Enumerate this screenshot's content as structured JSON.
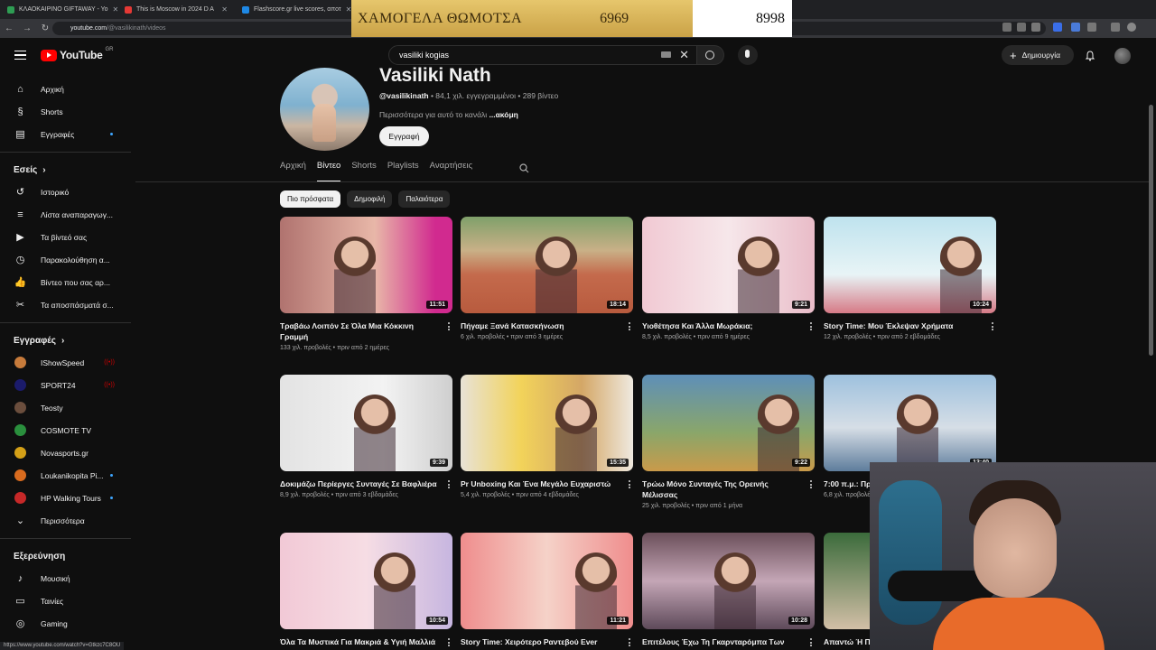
{
  "browser": {
    "tabs": [
      {
        "title": "ΚΛΑΟΚΑΙΡΙΝΟ GIFTAWAY - Yo",
        "color": "#2e9d53"
      },
      {
        "title": "This is Moscow in 2024 D A",
        "color": "#e53935"
      },
      {
        "title": "Flashscore.gr live scores, αποτ",
        "color": "#1e88e5"
      }
    ],
    "url_host": "youtube.com",
    "url_path": "/@vasilikinath/videos"
  },
  "overlay_ad": {
    "text": "ΧΑΜΟΓΕΛΑ ΘΩΜΟΤΣΑ",
    "number_left": "6969",
    "number_right": "8998"
  },
  "header": {
    "logo_text": "YouTube",
    "region": "GR",
    "search_value": "vasiliki kogias",
    "create_label": "Δημιουργία"
  },
  "sidebar": {
    "main": [
      {
        "label": "Αρχική",
        "icon": "home-icon",
        "glyph": "⌂"
      },
      {
        "label": "Shorts",
        "icon": "shorts-icon",
        "glyph": "§"
      },
      {
        "label": "Εγγραφές",
        "icon": "subscriptions-icon",
        "glyph": "▤"
      }
    ],
    "you_title": "Εσείς",
    "you": [
      {
        "label": "Ιστορικό",
        "icon": "history-icon",
        "glyph": "↺"
      },
      {
        "label": "Λίστα αναπαραγωγ...",
        "icon": "playlist-icon",
        "glyph": "≡"
      },
      {
        "label": "Τα βίντεό σας",
        "icon": "your-videos-icon",
        "glyph": "▶"
      },
      {
        "label": "Παρακολούθηση α...",
        "icon": "watch-later-icon",
        "glyph": "◷"
      },
      {
        "label": "Βίντεο που σας αρ...",
        "icon": "liked-icon",
        "glyph": "👍"
      },
      {
        "label": "Τα αποσπάσματά σ...",
        "icon": "clips-icon",
        "glyph": "✂"
      }
    ],
    "subs_title": "Εγγραφές",
    "subs": [
      {
        "label": "IShowSpeed",
        "color": "#c77b3b",
        "badge": "live"
      },
      {
        "label": "SPORT24",
        "color": "#1b1b6b",
        "badge": "live"
      },
      {
        "label": "Teosty",
        "color": "#6b4e3d",
        "badge": ""
      },
      {
        "label": "COSMOTE TV",
        "color": "#2a8f3d",
        "badge": ""
      },
      {
        "label": "Novasports.gr",
        "color": "#d4a017",
        "badge": ""
      },
      {
        "label": "Loukanikopita Pi...",
        "color": "#d96b1e",
        "badge": "dot"
      },
      {
        "label": "HP Walking Tours",
        "color": "#c62828",
        "badge": "dot"
      }
    ],
    "more_label": "Περισσότερα",
    "explore_title": "Εξερεύνηση",
    "explore": [
      {
        "label": "Μουσική",
        "icon": "music-icon",
        "glyph": "♪"
      },
      {
        "label": "Ταινίες",
        "icon": "movies-icon",
        "glyph": "▭"
      },
      {
        "label": "Gaming",
        "icon": "gaming-icon",
        "glyph": "◎"
      }
    ]
  },
  "channel": {
    "name": "Vasiliki Nath",
    "handle": "@vasilikinath",
    "stats": " • 84,1 χιλ. εγγεγραμμένοι • 289 βίντεο",
    "description": "Περισσότερα για αυτό το κανάλι ",
    "more": "...ακόμη",
    "subscribe_label": "Εγγραφή"
  },
  "tabs": [
    "Αρχική",
    "Βίντεο",
    "Shorts",
    "Playlists",
    "Αναρτήσεις"
  ],
  "active_tab": "Βίντεο",
  "chips": [
    "Πιο πρόσφατα",
    "Δημοφιλή",
    "Παλαιότερα"
  ],
  "videos": [
    {
      "title": "Τραβάω Λοιπόν Σε Όλα Μια Κόκκινη Γραμμή",
      "meta": "133 χιλ. προβολές • πριν από 2 ημέρες",
      "duration": "11:51",
      "bg": "linear-gradient(90deg,#b0736f,#e8b7a8 55%,#d12a8f 90%)"
    },
    {
      "title": "Πήγαμε Ξανά Κατασκήνωση",
      "meta": "6 χιλ. προβολές • πριν από 3 ημέρες",
      "duration": "18:14",
      "bg": "linear-gradient(180deg,#7fa06a 0%,#c9b087 35%,#c46a4c 60%,#b85b3e 100%)"
    },
    {
      "title": "Υιοθέτησα Και Άλλα Μωράκια;",
      "meta": "8,5 χιλ. προβολές • πριν από 9 ημέρες",
      "duration": "9:21",
      "bg": "linear-gradient(90deg,#f1c9d3,#f6e7ea 50%,#e9bcc8)"
    },
    {
      "title": "Story Time: Μου Έκλεψαν Χρήματα",
      "meta": "12 χιλ. προβολές • πριν από 2 εβδομάδες",
      "duration": "10:24",
      "bg": "linear-gradient(180deg,#bfe3ee 0%,#e8f4f6 60%,#d67a86 100%)"
    },
    {
      "title": "Δοκιμάζω Περίεργες Συνταγές Σε Βαφλιέρα",
      "meta": "8,9 χιλ. προβολές • πριν από 3 εβδομάδες",
      "duration": "9:39",
      "bg": "linear-gradient(90deg,#e3e3e3,#f3f3f3 60%,#cfcfcf)"
    },
    {
      "title": "Pr Unboxing Και Ένα Μεγάλο Ευχαριστώ",
      "meta": "5,4 χιλ. προβολές • πριν από 4 εβδομάδες",
      "duration": "15:35",
      "bg": "linear-gradient(90deg,#e8e2d6,#f2d35a 35%,#d4a766 70%,#efe9df)"
    },
    {
      "title": "Τρώω Μόνο Συνταγές Της Ορεινής Μέλισσας",
      "meta": "25 χιλ. προβολές • πριν από 1 μήνα",
      "duration": "9:22",
      "bg": "linear-gradient(180deg,#5e8fb8 0%,#8aa66a 60%,#c99a4a 100%)"
    },
    {
      "title": "7:00 π.μ.: Πρ",
      "meta": "6,8 χιλ. προβολές",
      "duration": "13:40",
      "bg": "linear-gradient(180deg,#9ec1de 0%,#d6dee6 55%,#5e7d9c 100%)"
    },
    {
      "title": "Όλα Τα Μυστικά Για Μακριά & Υγιή Μαλλιά",
      "meta": "",
      "duration": "10:54",
      "bg": "linear-gradient(90deg,#f2c9d6,#f6dde4 50%,#c7b6e0)"
    },
    {
      "title": "Story Time: Χειρότερο Ραντεβού Ever",
      "meta": "",
      "duration": "11:21",
      "bg": "linear-gradient(90deg,#ef8d8d,#f5d2c8 50%,#ef8d8d)"
    },
    {
      "title": "Επιτέλους Έχω Τη Γκαρνταρόμπα Των",
      "meta": "",
      "duration": "10:28",
      "bg": "linear-gradient(180deg,#6b4f5a,#c4a6b6 50%,#5e4a5a)"
    },
    {
      "title": "Απαντώ Ή Π",
      "meta": "",
      "duration": "",
      "bg": "linear-gradient(180deg,#3b6b3b,#d2bfa6)"
    }
  ],
  "status_url": "https://www.youtube.com/watch?v=Gtkzc7C8OU"
}
